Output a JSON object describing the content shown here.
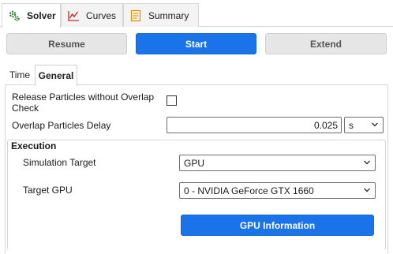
{
  "tabs": [
    {
      "label": "Solver",
      "icon": "gears-icon",
      "active": true
    },
    {
      "label": "Curves",
      "icon": "line-chart-icon",
      "active": false
    },
    {
      "label": "Summary",
      "icon": "document-icon",
      "active": false
    }
  ],
  "actions": {
    "resume": "Resume",
    "start": "Start",
    "extend": "Extend"
  },
  "subtabs": [
    {
      "label": "Time",
      "active": false
    },
    {
      "label": "General",
      "active": true
    }
  ],
  "general": {
    "release_label_line1": "Release Particles without Overlap",
    "release_label_line2": "Check",
    "release_checked": false,
    "delay_label": "Overlap Particles Delay",
    "delay_value": "0.025",
    "delay_unit": "s"
  },
  "execution": {
    "title": "Execution",
    "sim_target_label": "Simulation Target",
    "sim_target_value": "GPU",
    "target_gpu_label": "Target GPU",
    "target_gpu_value": "0 - NVIDIA GeForce GTX 1660",
    "gpu_info_button": "GPU Information"
  },
  "colors": {
    "accent": "#1a73e8",
    "button_grey": "#e6e6e6",
    "border": "#d6d6d6"
  }
}
